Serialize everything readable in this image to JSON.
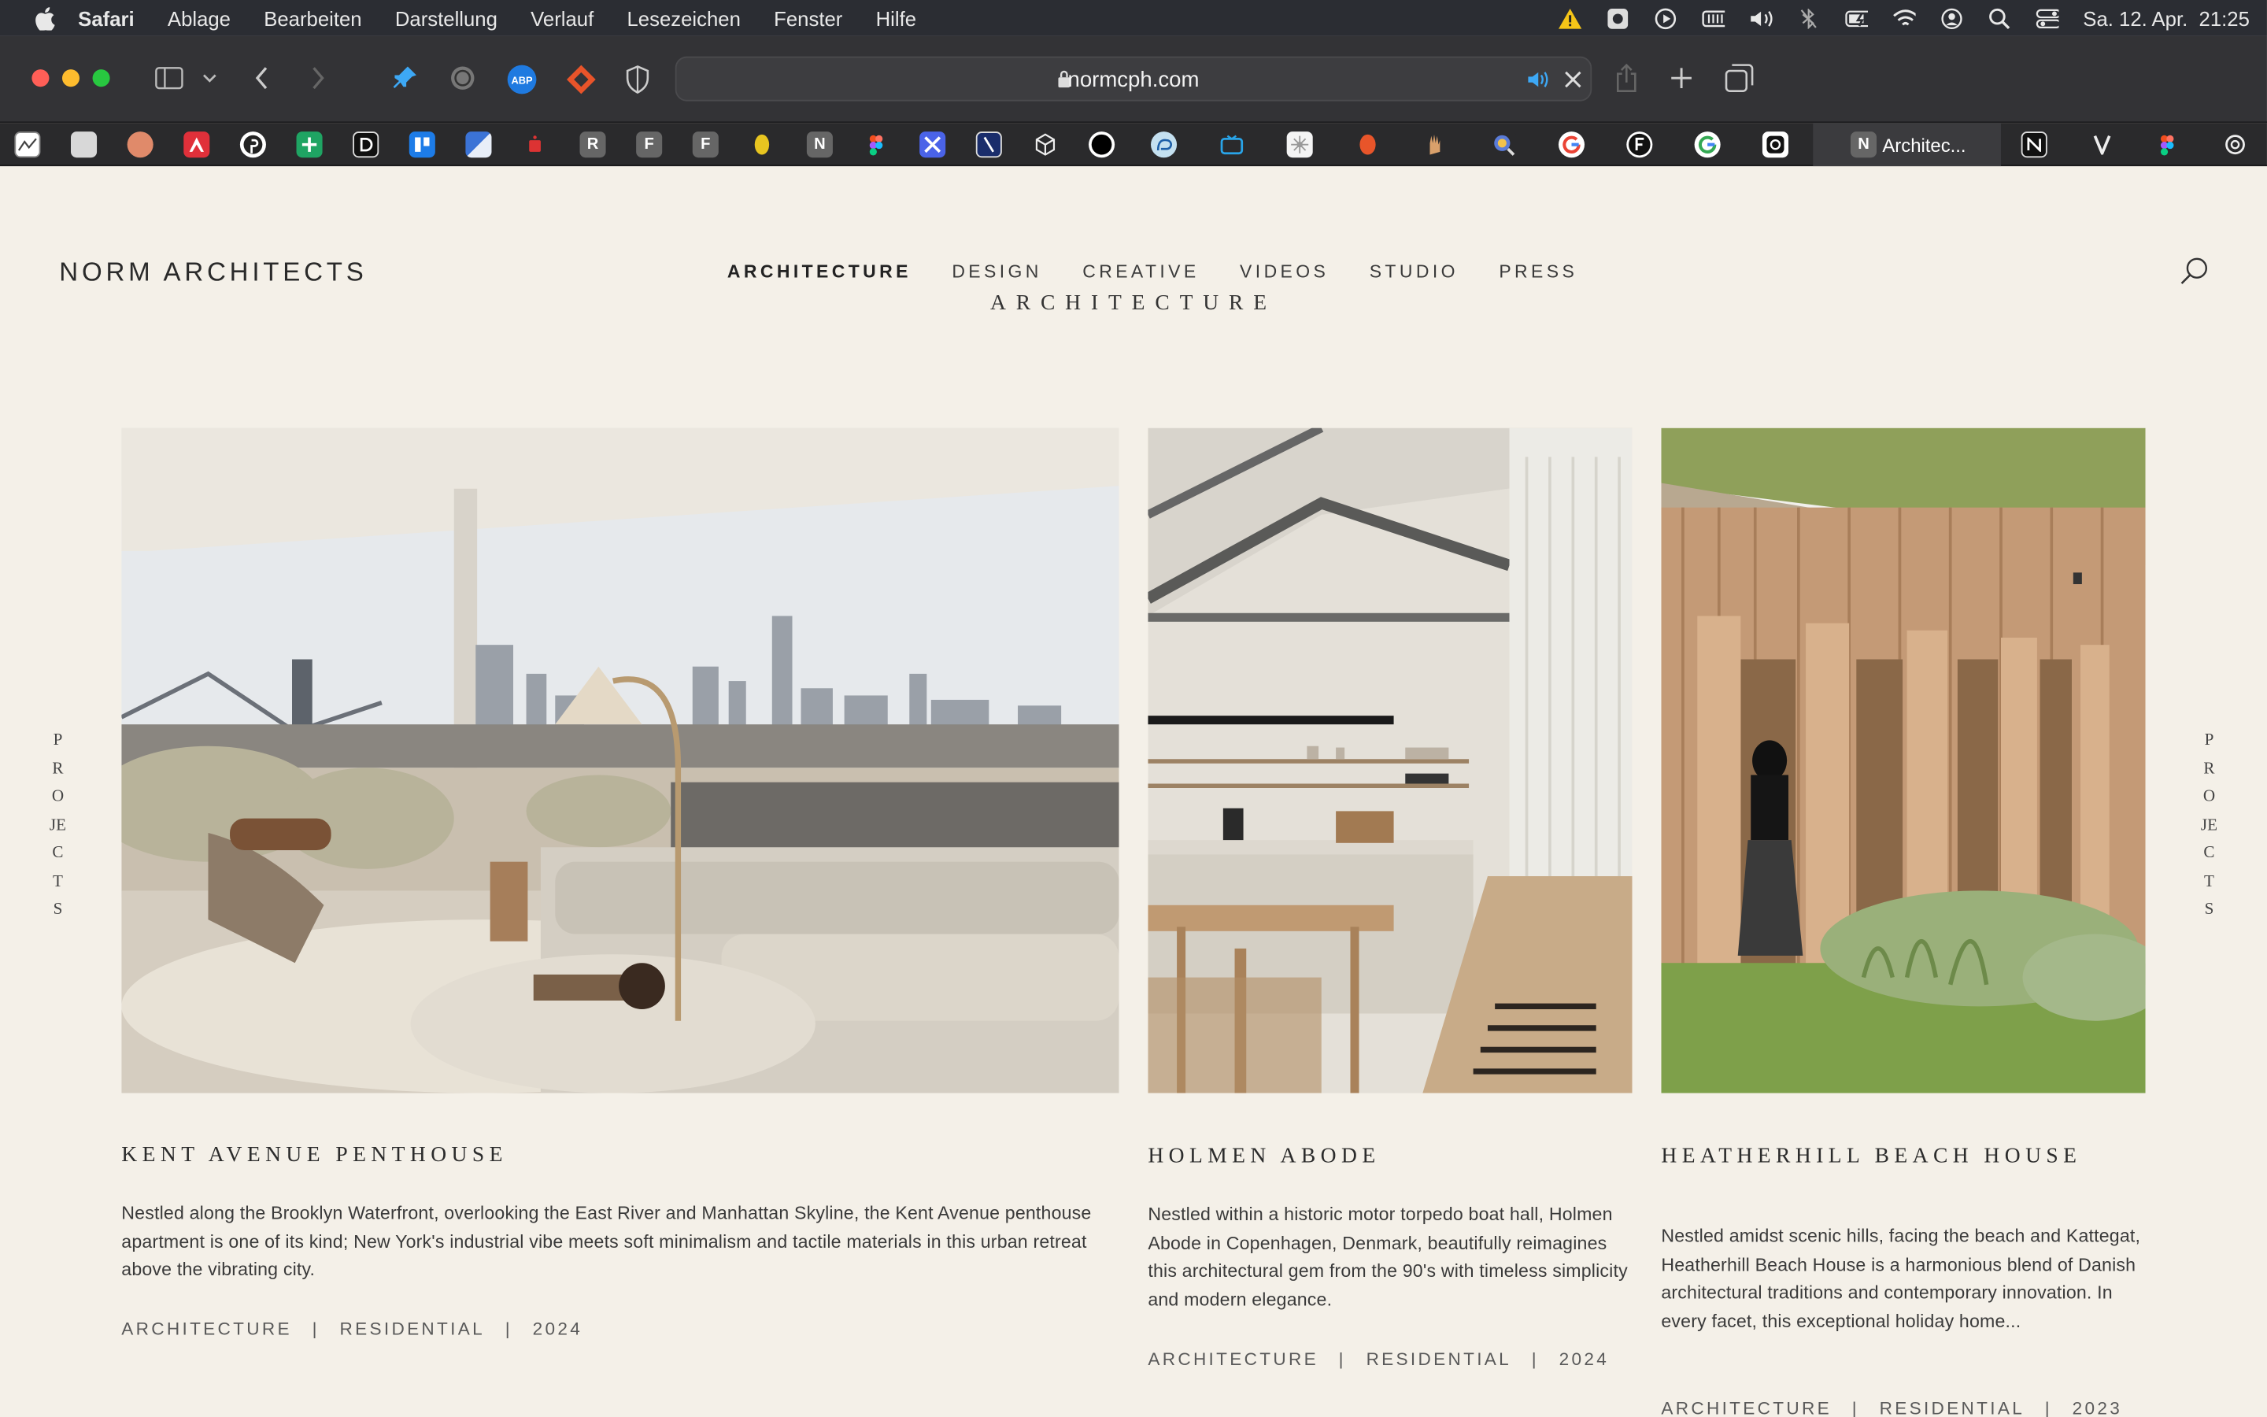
{
  "menubar": {
    "app": "Safari",
    "items": [
      "Ablage",
      "Bearbeiten",
      "Darstellung",
      "Verlauf",
      "Lesezeichen",
      "Fenster",
      "Hilfe"
    ],
    "clock": "Sa. 12. Apr.  21:25"
  },
  "browser": {
    "url": "normcph.com",
    "active_tab": "Architec...",
    "bookmark_letters": [
      "R",
      "F",
      "F",
      "N",
      "N"
    ]
  },
  "site": {
    "logo": "NORM ARCHITECTS",
    "nav": [
      "ARCHITECTURE",
      "DESIGN",
      "CREATIVE",
      "VIDEOS",
      "STUDIO",
      "PRESS"
    ],
    "section_title": "ARCHITECTURE",
    "side_label_left": "PROJECTS",
    "side_label_right": "PROJECTS"
  },
  "projects": [
    {
      "title": "KENT AVENUE PENTHOUSE",
      "description": "Nestled along the Brooklyn Waterfront, overlooking the East River and Manhattan Skyline, the Kent Avenue penthouse apartment is one of its kind; New York's industrial vibe meets soft minimalism and tactile materials in this urban retreat above the vibrating city.",
      "category": "ARCHITECTURE",
      "type": "RESIDENTIAL",
      "year": "2024"
    },
    {
      "title": "HOLMEN ABODE",
      "description": "Nestled within a historic motor torpedo boat hall, Holmen Abode in Copenhagen, Denmark, beautifully reimagines this architectural gem from the 90's with timeless simplicity and modern elegance.",
      "category": "ARCHITECTURE",
      "type": "RESIDENTIAL",
      "year": "2024"
    },
    {
      "title": "HEATHERHILL BEACH HOUSE",
      "description": "Nestled amidst scenic hills, facing the beach and Kattegat, Heatherhill Beach House is a harmonious blend of Danish architectural traditions and contemporary innovation. In every facet, this exceptional holiday home...",
      "category": "ARCHITECTURE",
      "type": "RESIDENTIAL",
      "year": "2023"
    }
  ],
  "colors": {
    "page_bg": "#f4f0e8",
    "menubar_bg": "#2b2d33",
    "toolbar_bg": "#333336"
  }
}
